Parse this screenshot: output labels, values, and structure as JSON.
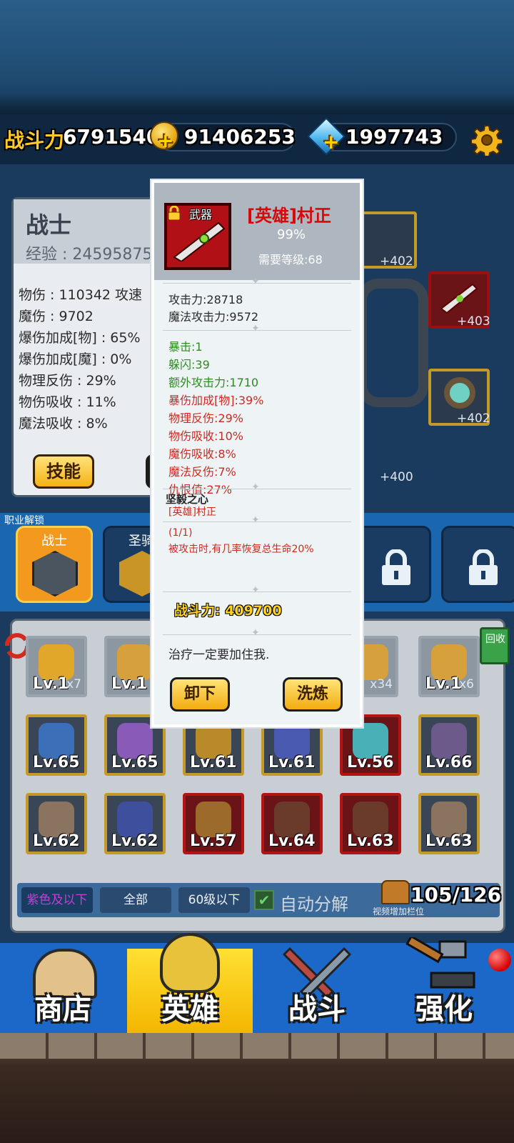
{
  "topbar": {
    "power_label": "战斗力",
    "power_value": "6791540",
    "gold_value": "91406253",
    "gems_value": "1997743",
    "icons": [
      "gold-coin-icon",
      "gem-icon",
      "settings-gear-icon"
    ]
  },
  "stats": {
    "class_name": "战士",
    "exp_text": "经验 : 24595875/19",
    "lines": [
      "物伤 : 110342  攻速",
      "魔伤 : 9702",
      "爆伤加成[物] : 65%",
      "爆伤加成[魔] : 0%",
      "物理反伤 : 29%",
      "物伤吸收 : 11%",
      "魔法吸收 : 8%"
    ],
    "skill_button": "技能"
  },
  "equip_slots": {
    "plus_values": [
      "+402",
      "+403",
      "+402",
      "+400"
    ]
  },
  "class_select": {
    "section_label": "职业解锁",
    "classes": [
      {
        "label": "战士",
        "state": "active"
      },
      {
        "label": "圣骑",
        "state": "unlocked"
      },
      {
        "label": "",
        "state": "locked"
      },
      {
        "label": "",
        "state": "locked"
      }
    ]
  },
  "inventory": {
    "recycle_label": "回收",
    "rows": [
      [
        {
          "level": "Lv.1",
          "qty": "x7",
          "color": "gold"
        },
        {
          "level": "Lv.1",
          "qty": "",
          "color": "gold"
        },
        {
          "level": "",
          "qty": "",
          "color": "gold"
        },
        {
          "level": "",
          "qty": "",
          "color": "gold"
        },
        {
          "level": "1",
          "qty": "x34",
          "color": "gold"
        },
        {
          "level": "Lv.1",
          "qty": "x6",
          "color": "gold"
        }
      ],
      [
        {
          "level": "Lv.65",
          "qty": "",
          "color": "gold"
        },
        {
          "level": "Lv.65",
          "qty": "",
          "color": "gold"
        },
        {
          "level": "Lv.61",
          "qty": "",
          "color": "gold"
        },
        {
          "level": "Lv.61",
          "qty": "",
          "color": "gold"
        },
        {
          "level": "Lv.56",
          "qty": "",
          "color": "red"
        },
        {
          "level": "Lv.66",
          "qty": "",
          "color": "gold"
        }
      ],
      [
        {
          "level": "Lv.62",
          "qty": "",
          "color": "gold"
        },
        {
          "level": "Lv.62",
          "qty": "",
          "color": "gold"
        },
        {
          "level": "Lv.57",
          "qty": "",
          "color": "red"
        },
        {
          "level": "Lv.64",
          "qty": "",
          "color": "red"
        },
        {
          "level": "Lv.63",
          "qty": "",
          "color": "red"
        },
        {
          "level": "Lv.63",
          "qty": "",
          "color": "gold"
        }
      ]
    ],
    "filters": [
      "紫色及以下",
      "全部",
      "60级以下"
    ],
    "auto_label": "自动分解",
    "bag_count": "105/126",
    "bag_note": "视频增加栏位"
  },
  "nav": {
    "tabs": [
      {
        "label": "商店",
        "icon": "shop-house-icon"
      },
      {
        "label": "英雄",
        "icon": "hero-helmet-icon"
      },
      {
        "label": "战斗",
        "icon": "crossed-swords-icon"
      },
      {
        "label": "强化",
        "icon": "hammer-anvil-icon"
      }
    ],
    "active": "英雄"
  },
  "popup": {
    "weapon_type": "武器",
    "weapon_name": "[英雄]村正",
    "quality": "99%",
    "required_level": "需要等级:68",
    "base_stats": [
      "攻击力:28718",
      "魔法攻击力:9572"
    ],
    "green_stats": [
      "暴击:1",
      "躲闪:39",
      "额外攻击力:1710"
    ],
    "red_stats": [
      "暴伤加成[物]:39%",
      "物理反伤:29%",
      "物伤吸收:10%",
      "魔伤吸收:8%",
      "魔法反伤:7%",
      "仇恨值:27%"
    ],
    "set_name": "坚毅之心",
    "set_item": "[英雄]村正",
    "set_count": "(1/1)",
    "set_effect": "被攻击时,有几率恢复总生命20%",
    "power": "战斗力: 409700",
    "description": "治疗一定要加住我.",
    "unequip_button": "卸下",
    "refine_button": "洗炼"
  }
}
